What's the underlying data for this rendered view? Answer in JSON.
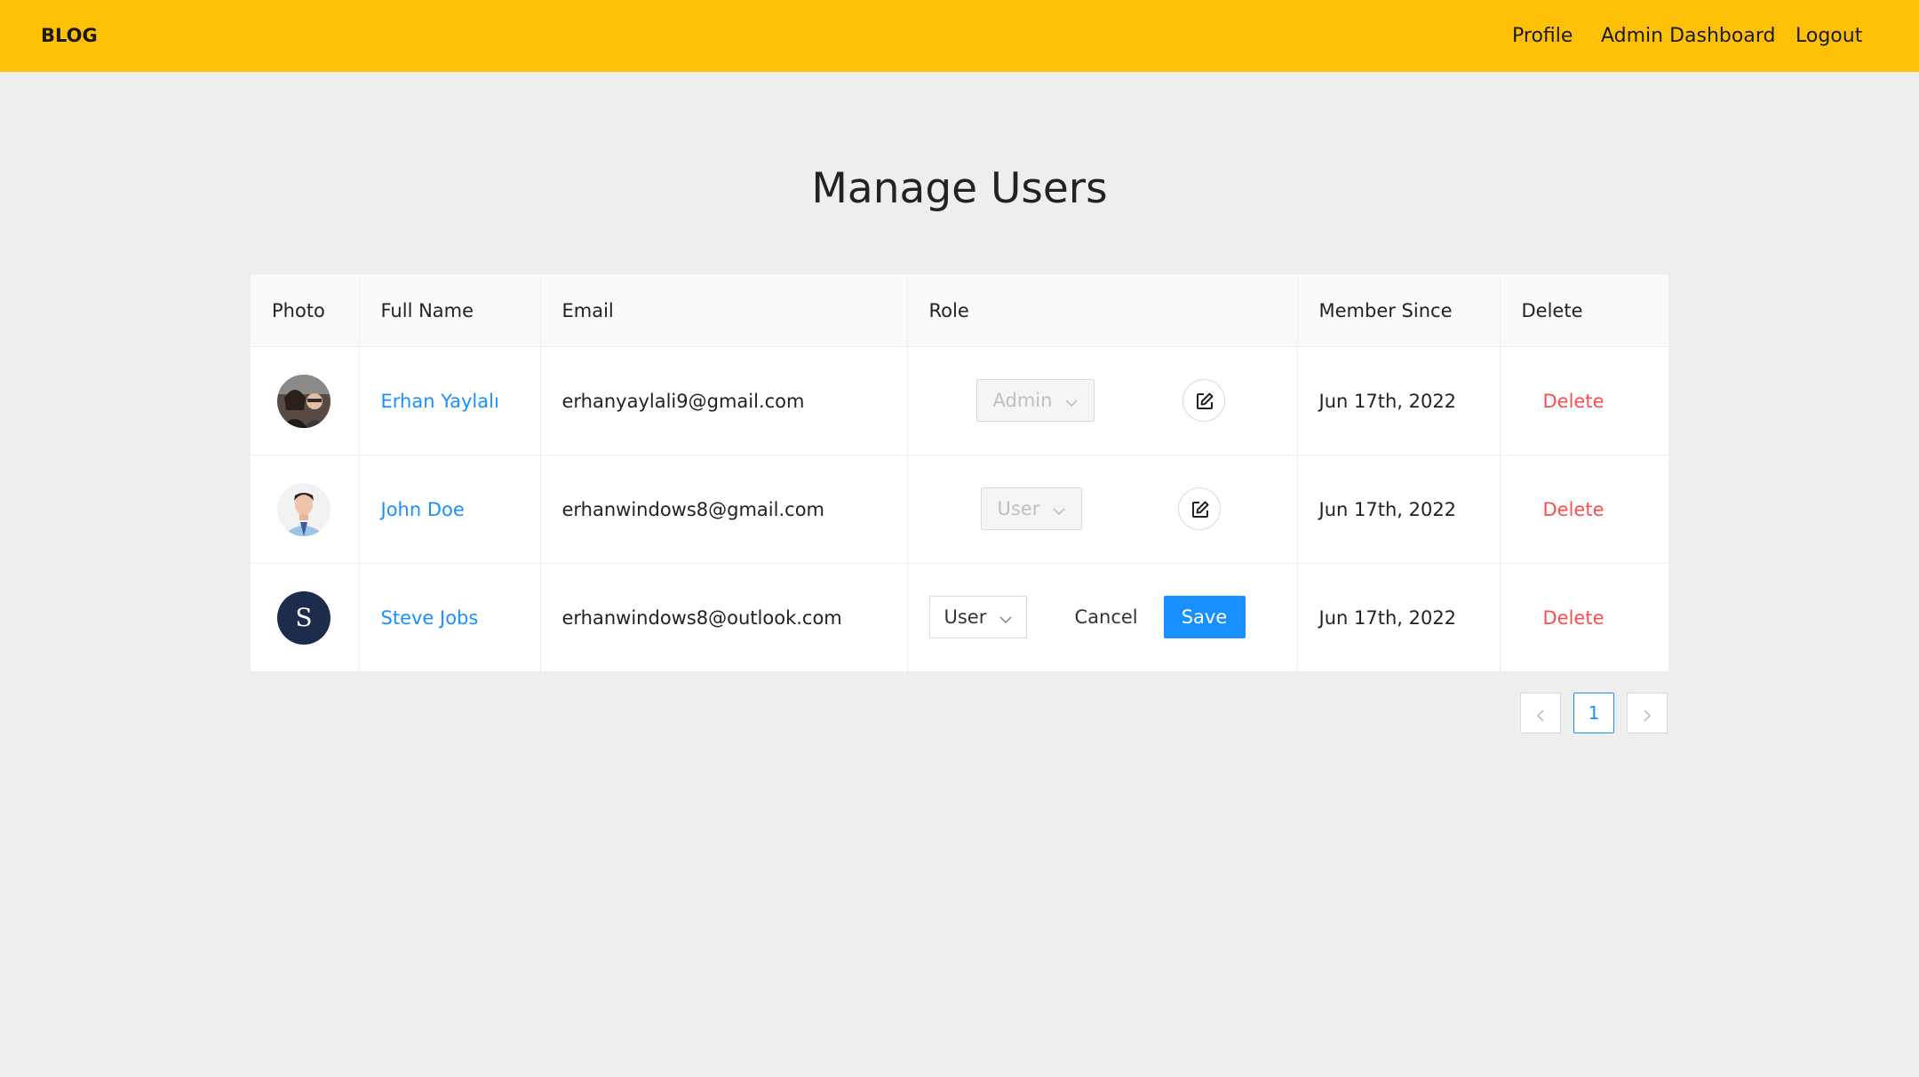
{
  "nav": {
    "brand": "BLOG",
    "links": [
      "Profile",
      "Admin Dashboard",
      "Logout"
    ]
  },
  "page": {
    "title": "Manage Users"
  },
  "table": {
    "headers": [
      "Photo",
      "Full Name",
      "Email",
      "Role",
      "Member Since",
      "Delete"
    ],
    "rows": [
      {
        "name": "Erhan Yaylalı",
        "email": "erhanyaylali9@gmail.com",
        "role": "Admin",
        "member_since": "Jun 17th, 2022",
        "delete": "Delete"
      },
      {
        "name": "John Doe",
        "email": "erhanwindows8@gmail.com",
        "role": "User",
        "member_since": "Jun 17th, 2022",
        "delete": "Delete"
      },
      {
        "name": "Steve Jobs",
        "avatar_letter": "S",
        "email": "erhanwindows8@outlook.com",
        "role": "User",
        "cancel": "Cancel",
        "save": "Save",
        "member_since": "Jun 17th, 2022",
        "delete": "Delete"
      }
    ]
  },
  "pagination": {
    "prev": "<",
    "current": "1",
    "next": ">"
  },
  "colors": {
    "navbar": "#ffc107",
    "link": "#1890ff",
    "danger": "#ff4d4f",
    "primary": "#1890ff",
    "avatar_letter_bg": "#1d2c4c"
  }
}
